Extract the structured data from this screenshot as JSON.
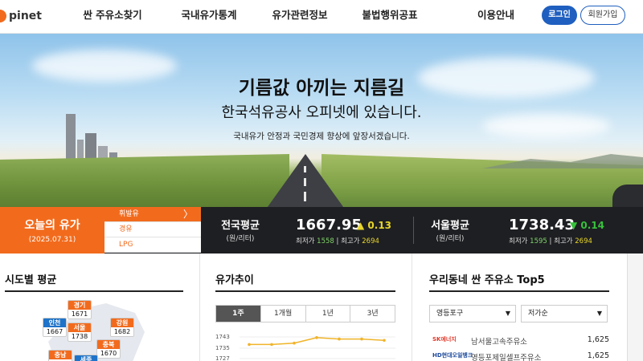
{
  "header": {
    "logo_text": "pinet",
    "nav": [
      "싼 주유소찾기",
      "국내유가통계",
      "유가관련정보",
      "불법행위공표",
      "이용안내"
    ],
    "login_label": "로그인",
    "join_label": "회원가입"
  },
  "hero": {
    "title": "기름값 아끼는 지름길",
    "subtitle": "한국석유공사 오피넷에 있습니다.",
    "description": "국내유가 안정과 국민경제 향상에 앞장서겠습니다."
  },
  "today_price": {
    "title": "오늘의 유가",
    "date": "(2025.07.31)",
    "fuel_tabs": [
      "휘발유",
      "경유",
      "LPG"
    ],
    "active_fuel": "휘발유",
    "chevron": "〉"
  },
  "national_avg": {
    "label": "전국평균",
    "unit": "(원/리터)",
    "price": "1667.95",
    "change": "▲ 0.13",
    "min_label": "최저가",
    "min": "1558",
    "max_label": "최고가",
    "max": "2694",
    "direction": "up"
  },
  "seoul_avg": {
    "label": "서울평균",
    "unit": "(원/리터)",
    "price": "1738.43",
    "change": "▼ 0.14",
    "min_label": "최저가",
    "min": "1595",
    "max_label": "최고가",
    "max": "2694",
    "direction": "down"
  },
  "regional": {
    "title": "시도별 평균",
    "regions": [
      {
        "name": "경기",
        "value": "1671",
        "color": "orange"
      },
      {
        "name": "인천",
        "value": "1667",
        "color": "blue"
      },
      {
        "name": "서울",
        "value": "1738",
        "color": "orange"
      },
      {
        "name": "강원",
        "value": "1682",
        "color": "orange"
      },
      {
        "name": "충북",
        "value": "1670",
        "color": "orange"
      },
      {
        "name": "충남",
        "value": "",
        "color": "orange"
      },
      {
        "name": "세종",
        "value": "",
        "color": "blue"
      }
    ]
  },
  "trend": {
    "title": "유가추이",
    "periods": [
      "1주",
      "1개월",
      "1년",
      "3년"
    ],
    "active_period": "1주",
    "yticks": [
      "1743",
      "1735",
      "1727"
    ],
    "chart_data": {
      "type": "line",
      "series": [
        {
          "values": [
            1736,
            1736,
            1737,
            1741,
            1740,
            1740,
            1739
          ]
        }
      ],
      "ylim": [
        1724,
        1745
      ]
    }
  },
  "top5": {
    "title": "우리동네 싼 주유소 Top5",
    "district": "영등포구",
    "sort": "저가순",
    "caret": "▼",
    "stations": [
      {
        "brand": "SK에너지",
        "name": "남서울고속주유소",
        "price": "1,625",
        "brand_color": "#e03a2b"
      },
      {
        "brand": "HD현대오일뱅크",
        "name": "영등포제일셀프주유소",
        "price": "1,625",
        "brand_color": "#1d4a9c"
      }
    ]
  }
}
